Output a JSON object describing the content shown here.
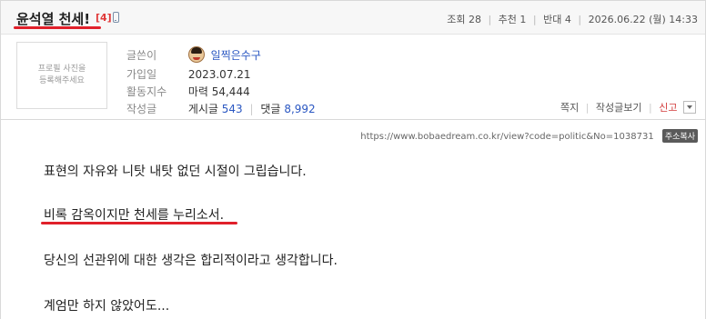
{
  "post": {
    "title": "윤석열 천세!",
    "comment_count": "[4]",
    "stats": {
      "views_label": "조회",
      "views": "28",
      "recommend_label": "추천",
      "recommend": "1",
      "oppose_label": "반대",
      "oppose": "4",
      "date": "2026.06.22 (월) 14:33"
    }
  },
  "author": {
    "profile_placeholder_line1": "프로필 사진을",
    "profile_placeholder_line2": "등록해주세요",
    "writer_label": "글쓴이",
    "nickname": "일찍은수구",
    "joined_label": "가입일",
    "joined": "2023.07.21",
    "activity_label": "활동지수",
    "activity": "마력 54,444",
    "posts_label": "작성글",
    "posts_text": "게시글",
    "posts_count": "543",
    "comments_text": "댓글",
    "comments_count": "8,992"
  },
  "actions": {
    "message": "쪽지",
    "view_posts": "작성글보기",
    "report": "신고"
  },
  "url": {
    "text": "https://www.bobaedream.co.kr/view?code=politic&No=1038731",
    "copy_label": "주소복사"
  },
  "content": {
    "line1": " 표현의 자유와 니탓 내탓 없던 시절이 그립습니다.",
    "line2": "비록 감옥이지만 천세를 누리소서.",
    "line3": "당신의 선관위에 대한 생각은 합리적이라고 생각합니다.",
    "line4": "계엄만 하지 않았어도..."
  },
  "colors": {
    "underline": "#e0202a",
    "link_blue": "#2a57c2",
    "report_red": "#d23b3b"
  }
}
